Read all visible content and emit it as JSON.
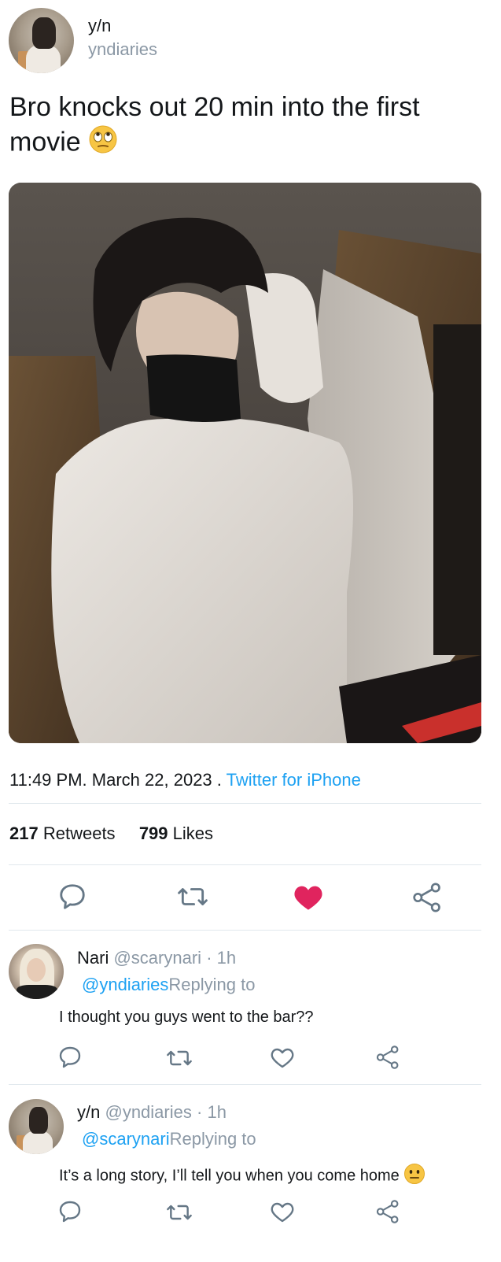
{
  "tweet": {
    "author_name": "y/n",
    "author_handle": "yndiaries",
    "text": "Bro knocks out 20 min into the first movie",
    "text_emoji": "face-with-rolling-eyes-icon",
    "time": "11:49 PM",
    "date": "March 22, 2023",
    "sep1": ".",
    "sep2": ".",
    "source": "Twitter for iPhone",
    "retweets_count": "217",
    "retweets_label": "Retweets",
    "likes_count": "799",
    "likes_label": "Likes",
    "liked": true,
    "like_color": "#e0245e",
    "link_color": "#1da1f2"
  },
  "replies": [
    {
      "name": "Nari",
      "handle": "@scarynari",
      "dot": "·",
      "time": "1h",
      "mention": "@yndiaries",
      "replying_label": "Replying to",
      "text": "I thought you guys went to the bar??"
    },
    {
      "name": "y/n",
      "handle": "@yndiaries",
      "dot": "·",
      "time": "1h",
      "mention": "@scarynari",
      "replying_label": "Replying to",
      "text": "It’s a long story, I’ll tell you when you come home",
      "text_emoji": "neutral-face-icon"
    }
  ]
}
